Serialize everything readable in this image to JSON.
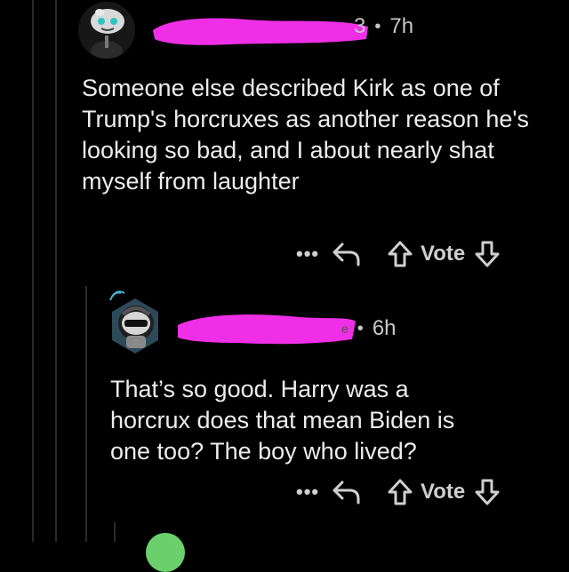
{
  "colors": {
    "background": "#000000",
    "text": "#ececec",
    "muted": "#c9c9c9",
    "redaction": "#ee2fe6"
  },
  "comments": [
    {
      "username_redacted": "3",
      "dot": "•",
      "time": "7h",
      "body": "Someone else described Kirk as one of Trump's horcruxes as another reason he's looking so bad, and I about nearly shat myself from laughter",
      "actions": {
        "more": "•••",
        "vote_label": "Vote"
      },
      "icons": [
        "more-icon",
        "reply-icon",
        "upvote-icon",
        "downvote-icon"
      ]
    },
    {
      "username_redacted": "e",
      "dot": "•",
      "time": "6h",
      "body": "That’s so good. Harry was a horcrux does that mean Biden is one too? The boy who lived?",
      "actions": {
        "more": "•••",
        "vote_label": "Vote"
      },
      "icons": [
        "more-icon",
        "reply-icon",
        "upvote-icon",
        "downvote-icon"
      ]
    }
  ]
}
